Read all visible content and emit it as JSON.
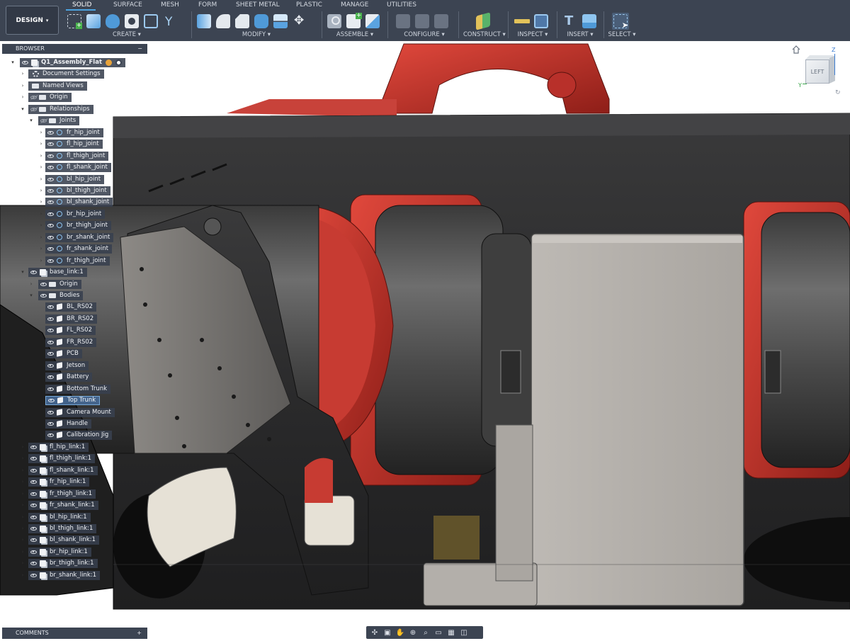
{
  "toolbar": {
    "workspace": "DESIGN",
    "tabs": [
      {
        "label": "SOLID",
        "active": true
      },
      {
        "label": "SURFACE"
      },
      {
        "label": "MESH"
      },
      {
        "label": "FORM"
      },
      {
        "label": "SHEET METAL"
      },
      {
        "label": "PLASTIC"
      },
      {
        "label": "MANAGE"
      },
      {
        "label": "UTILITIES"
      }
    ],
    "groups": [
      {
        "label": "CREATE",
        "icons": [
          "new-component-icon",
          "extrude-icon",
          "revolve-icon",
          "hole-icon",
          "pattern-icon",
          "fork-icon"
        ]
      },
      {
        "label": "MODIFY",
        "icons": [
          "press-pull-icon",
          "fillet-icon",
          "chamfer-icon",
          "shell-icon",
          "split-body-icon",
          "move-icon"
        ]
      },
      {
        "label": "ASSEMBLE",
        "icons": [
          "joint-icon",
          "new-component-assemble-icon",
          "as-built-joint-icon"
        ]
      },
      {
        "label": "CONFIGURE",
        "icons": [
          "configure-table-icon",
          "configure-rules-icon",
          "configure-theme-icon"
        ]
      },
      {
        "label": "CONSTRUCT",
        "icons": [
          "offset-plane-icon"
        ]
      },
      {
        "label": "INSPECT",
        "icons": [
          "measure-icon",
          "interference-icon"
        ]
      },
      {
        "label": "INSERT",
        "icons": [
          "insert-derive-icon",
          "insert-image-icon"
        ]
      },
      {
        "label": "SELECT",
        "icons": [
          "window-select-icon"
        ]
      }
    ],
    "colors": {
      "bar": "#3c4452",
      "accent": "#4ca3e0"
    }
  },
  "browser": {
    "title": "BROWSER",
    "collapse": "−",
    "items": [
      {
        "label": "Q1_Assembly_Flat",
        "icon": "component-icon",
        "eye": "on",
        "level": 0,
        "caret": "open",
        "root": true
      },
      {
        "label": "Document Settings",
        "icon": "gear-icon",
        "eye": "none",
        "level": 1,
        "caret": "closed"
      },
      {
        "label": "Named Views",
        "icon": "folder-icon",
        "eye": "none",
        "level": 1,
        "caret": "closed"
      },
      {
        "label": "Origin",
        "icon": "folder-icon",
        "eye": "off",
        "level": 1,
        "caret": "closed"
      },
      {
        "label": "Relationships",
        "icon": "folder-icon",
        "eye": "off",
        "level": 1,
        "caret": "open"
      },
      {
        "label": "Joints",
        "icon": "folder-icon",
        "eye": "off",
        "level": 2,
        "caret": "open"
      },
      {
        "label": "fr_hip_joint",
        "icon": "joint-icon",
        "eye": "on",
        "level": 3,
        "caret": "closed"
      },
      {
        "label": "fl_hip_joint",
        "icon": "joint-icon",
        "eye": "on",
        "level": 3,
        "caret": "closed"
      },
      {
        "label": "fl_thigh_joint",
        "icon": "joint-icon",
        "eye": "on",
        "level": 3,
        "caret": "closed"
      },
      {
        "label": "fl_shank_joint",
        "icon": "joint-icon",
        "eye": "on",
        "level": 3,
        "caret": "closed"
      },
      {
        "label": "bl_hip_joint",
        "icon": "joint-icon",
        "eye": "on",
        "level": 3,
        "caret": "closed"
      },
      {
        "label": "bl_thigh_joint",
        "icon": "joint-icon",
        "eye": "on",
        "level": 3,
        "caret": "closed"
      },
      {
        "label": "bl_shank_joint",
        "icon": "joint-icon",
        "eye": "on",
        "level": 3,
        "caret": "closed"
      },
      {
        "label": "br_hip_joint",
        "icon": "joint-icon",
        "eye": "on",
        "level": 3,
        "caret": "closed"
      },
      {
        "label": "br_thigh_joint",
        "icon": "joint-icon",
        "eye": "on",
        "level": 3,
        "caret": "closed"
      },
      {
        "label": "br_shank_joint",
        "icon": "joint-icon",
        "eye": "on",
        "level": 3,
        "caret": "closed"
      },
      {
        "label": "fr_shank_joint",
        "icon": "joint-icon",
        "eye": "on",
        "level": 3,
        "caret": "closed"
      },
      {
        "label": "fr_thigh_joint",
        "icon": "joint-icon",
        "eye": "on",
        "level": 3,
        "caret": "closed"
      },
      {
        "label": "base_link:1",
        "icon": "component-icon",
        "eye": "on",
        "level": 1,
        "caret": "open"
      },
      {
        "label": "Origin",
        "icon": "folder-icon",
        "eye": "on",
        "level": 2,
        "caret": "closed"
      },
      {
        "label": "Bodies",
        "icon": "folder-icon",
        "eye": "on",
        "level": 2,
        "caret": "open"
      },
      {
        "label": "BL_RS02",
        "icon": "body-icon",
        "eye": "on",
        "level": 3,
        "caret": "none"
      },
      {
        "label": "BR_RS02",
        "icon": "body-icon",
        "eye": "on",
        "level": 3,
        "caret": "none"
      },
      {
        "label": "FL_RS02",
        "icon": "body-icon",
        "eye": "on",
        "level": 3,
        "caret": "none"
      },
      {
        "label": "FR_RS02",
        "icon": "body-icon",
        "eye": "on",
        "level": 3,
        "caret": "none"
      },
      {
        "label": "PCB",
        "icon": "body-icon",
        "eye": "on",
        "level": 3,
        "caret": "none"
      },
      {
        "label": "Jetson",
        "icon": "body-icon",
        "eye": "on",
        "level": 3,
        "caret": "none"
      },
      {
        "label": "Battery",
        "icon": "body-icon",
        "eye": "on",
        "level": 3,
        "caret": "none"
      },
      {
        "label": "Bottom Trunk",
        "icon": "body-icon",
        "eye": "on",
        "level": 3,
        "caret": "none"
      },
      {
        "label": "Top Trunk",
        "icon": "body-icon",
        "eye": "on",
        "level": 3,
        "caret": "none",
        "selected": true
      },
      {
        "label": "Camera Mount",
        "icon": "body-icon",
        "eye": "on",
        "level": 3,
        "caret": "none"
      },
      {
        "label": "Handle",
        "icon": "body-icon",
        "eye": "on",
        "level": 3,
        "caret": "none"
      },
      {
        "label": "Calibration Jig",
        "icon": "body-icon",
        "eye": "on",
        "level": 3,
        "caret": "none"
      },
      {
        "label": "fl_hip_link:1",
        "icon": "component-icon",
        "eye": "on",
        "level": 1,
        "caret": "closed"
      },
      {
        "label": "fl_thigh_link:1",
        "icon": "component-icon",
        "eye": "on",
        "level": 1,
        "caret": "closed"
      },
      {
        "label": "fl_shank_link:1",
        "icon": "component-icon",
        "eye": "on",
        "level": 1,
        "caret": "closed"
      },
      {
        "label": "fr_hip_link:1",
        "icon": "component-icon",
        "eye": "on",
        "level": 1,
        "caret": "closed"
      },
      {
        "label": "fr_thigh_link:1",
        "icon": "component-icon",
        "eye": "on",
        "level": 1,
        "caret": "closed"
      },
      {
        "label": "fr_shank_link:1",
        "icon": "component-icon",
        "eye": "on",
        "level": 1,
        "caret": "closed"
      },
      {
        "label": "bl_hip_link:1",
        "icon": "component-icon",
        "eye": "on",
        "level": 1,
        "caret": "closed"
      },
      {
        "label": "bl_thigh_link:1",
        "icon": "component-icon",
        "eye": "on",
        "level": 1,
        "caret": "closed"
      },
      {
        "label": "bl_shank_link:1",
        "icon": "component-icon",
        "eye": "on",
        "level": 1,
        "caret": "closed"
      },
      {
        "label": "br_hip_link:1",
        "icon": "component-icon",
        "eye": "on",
        "level": 1,
        "caret": "closed"
      },
      {
        "label": "br_thigh_link:1",
        "icon": "component-icon",
        "eye": "on",
        "level": 1,
        "caret": "closed"
      },
      {
        "label": "br_shank_link:1",
        "icon": "component-icon",
        "eye": "on",
        "level": 1,
        "caret": "closed"
      }
    ]
  },
  "viewcube": {
    "face": "LEFT",
    "axis_z": "Z",
    "axis_y": "Y"
  },
  "comments": {
    "title": "COMMENTS",
    "add": "+"
  },
  "navbar": {
    "icons": [
      "orbit-icon",
      "look-at-icon",
      "pan-icon",
      "zoom-icon",
      "fit-icon",
      "display-settings-icon",
      "grid-icon",
      "viewports-icon"
    ]
  }
}
